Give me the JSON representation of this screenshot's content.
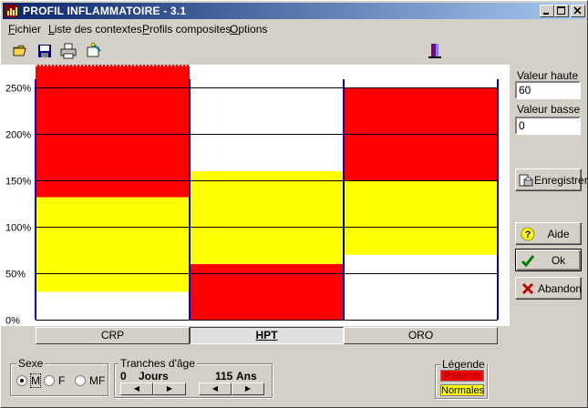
{
  "window": {
    "title": "PROFIL INFLAMMATOIRE - 3.1",
    "controls": [
      "minimize",
      "maximize",
      "close"
    ]
  },
  "menu": {
    "items": [
      "Fichier",
      "Liste des contextes",
      "Profils composites",
      "Options"
    ]
  },
  "toolbar": {
    "icons": [
      "open-folder-icon",
      "save-disk-icon",
      "print-icon",
      "wizard-icon",
      "exit-door-icon"
    ]
  },
  "chart_data": {
    "type": "bar",
    "categories": [
      "CRP",
      "HPT",
      "ORO"
    ],
    "yticks": [
      "0%",
      "50%",
      "100%",
      "150%",
      "200%",
      "250%"
    ],
    "ylim": [
      0,
      275
    ],
    "series": [
      {
        "name": "Patients",
        "color": "#ff0000",
        "ranges": [
          [
            132,
            275
          ],
          [
            0,
            60
          ],
          [
            150,
            250
          ]
        ]
      },
      {
        "name": "Normales",
        "color": "#ffff00",
        "ranges": [
          [
            30,
            132
          ],
          [
            60,
            160
          ],
          [
            70,
            150
          ]
        ]
      }
    ],
    "grid": true,
    "active_category": "HPT"
  },
  "side": {
    "valeur_haute_label": "Valeur haute",
    "valeur_haute": "60",
    "valeur_basse_label": "Valeur basse",
    "valeur_basse": "0",
    "enregistrer": "Enregistrer",
    "aide": "Aide",
    "ok": "Ok",
    "abandon": "Abandon"
  },
  "sexe": {
    "title": "Sexe",
    "options": [
      "M",
      "F",
      "MF"
    ],
    "selected": "M"
  },
  "tranches": {
    "title": "Tranches d'âge",
    "low": "0",
    "low_unit": "Jours",
    "high": "115",
    "high_unit": "Ans"
  },
  "legende": {
    "title": "Légende",
    "patients": "Patients",
    "normales": "Normales",
    "patients_color": "#ff0000",
    "normales_color": "#ffff00"
  }
}
